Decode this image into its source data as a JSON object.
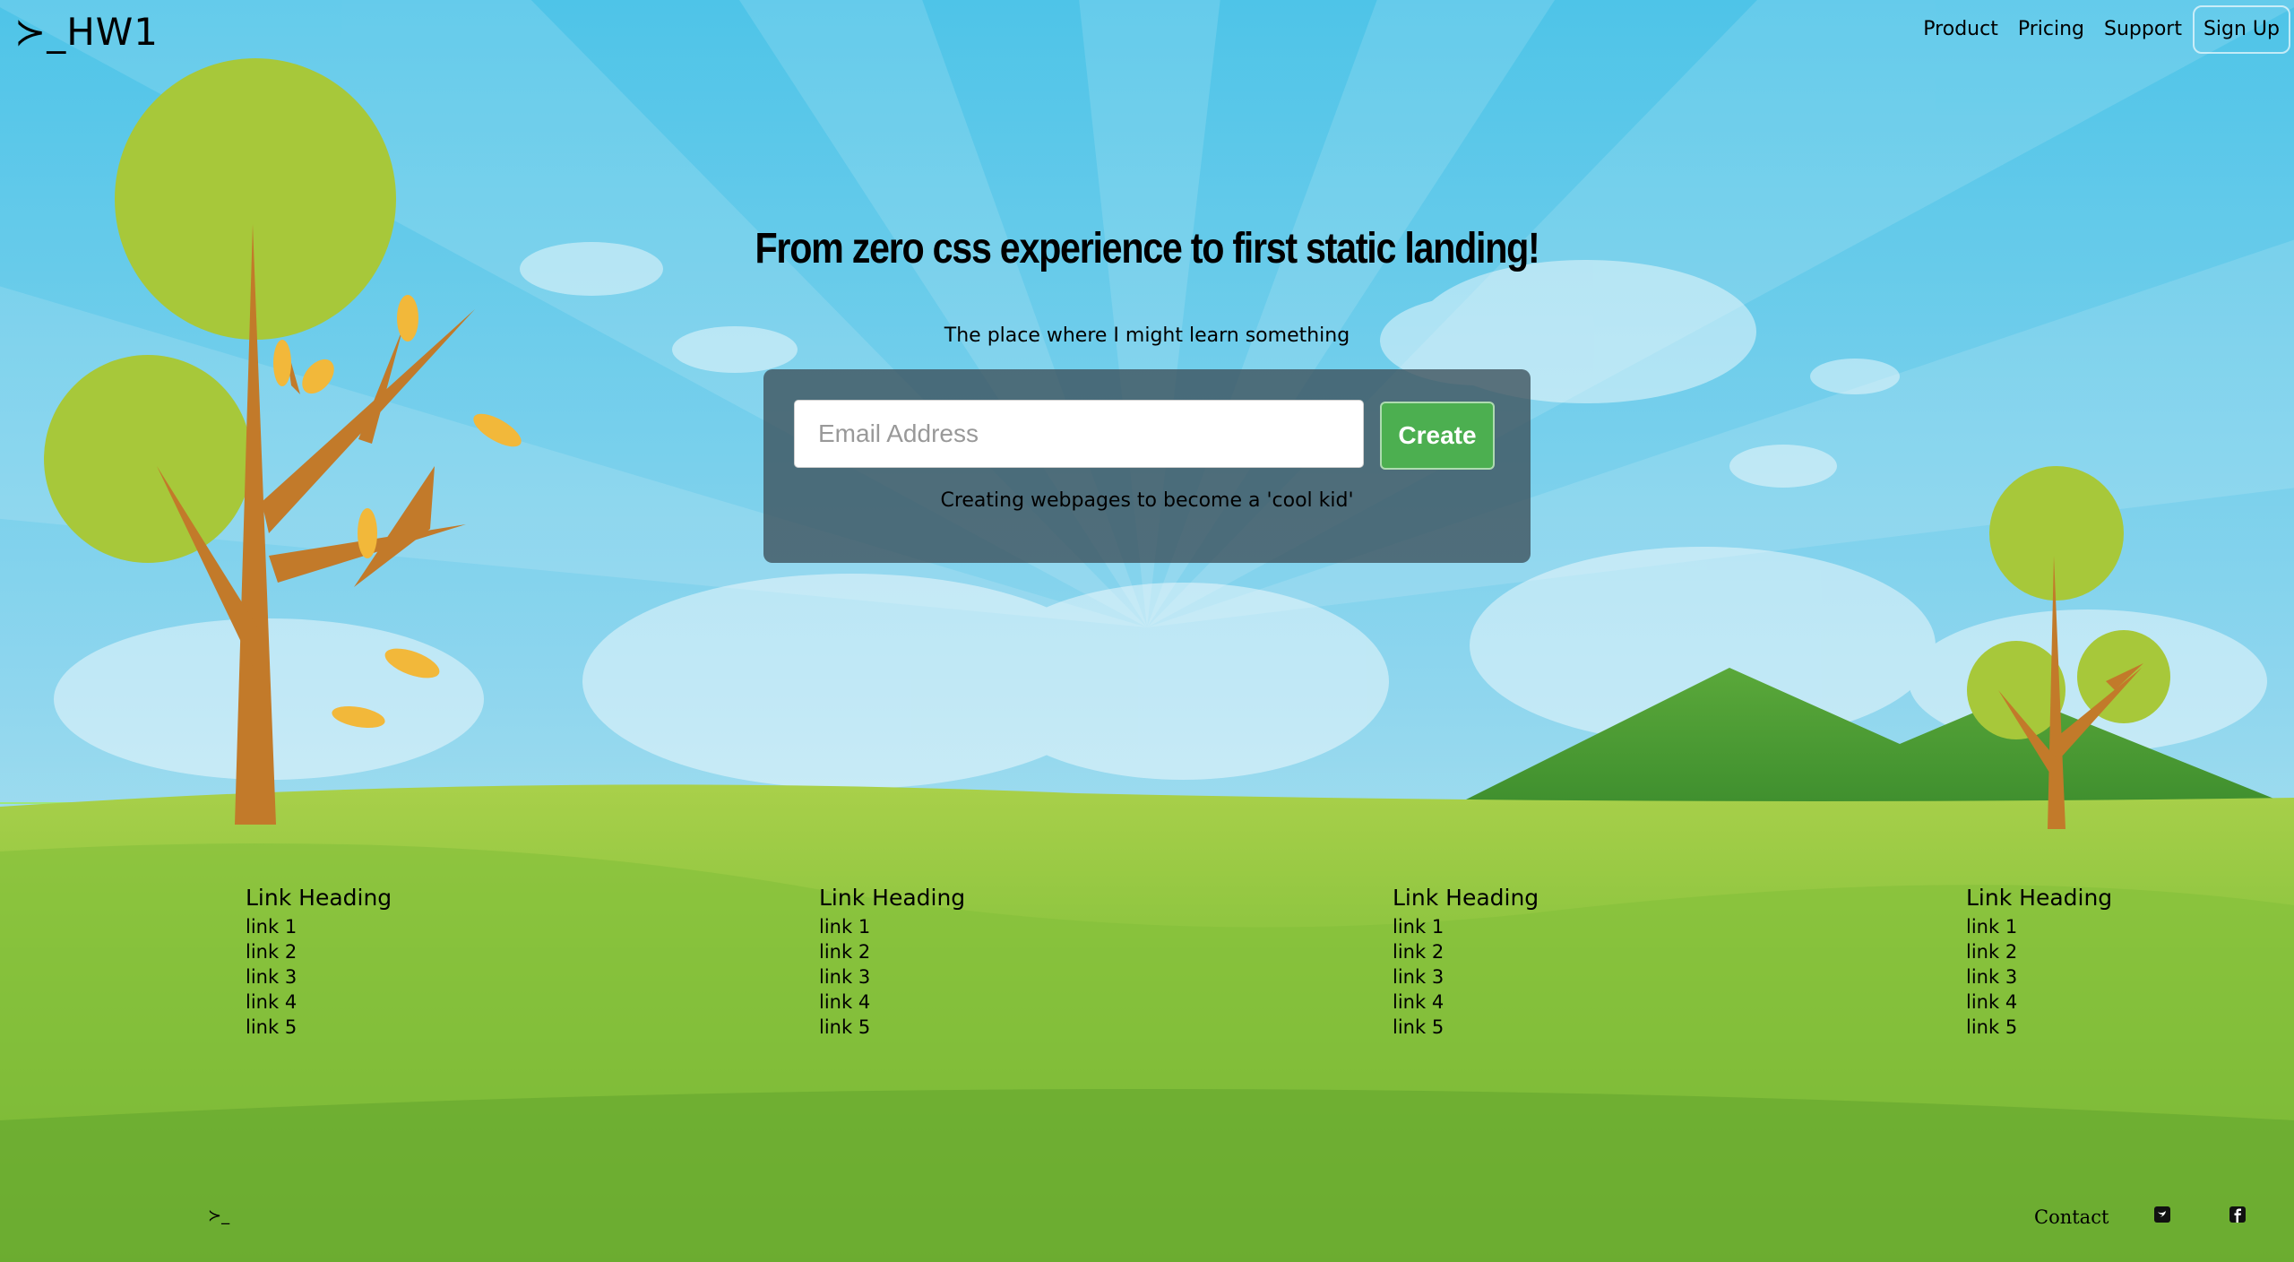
{
  "brand": {
    "text": "≻_HW1"
  },
  "nav": {
    "items": [
      "Product",
      "Pricing",
      "Support"
    ],
    "signup": "Sign Up"
  },
  "hero": {
    "title": "From zero css experience to first static landing!",
    "subtitle": "The place where I might learn something",
    "email_placeholder": "Email Address",
    "create_label": "Create",
    "note": "Creating webpages to become a 'cool kid'"
  },
  "link_columns": [
    {
      "heading": "Link Heading",
      "links": [
        "link 1",
        "link 2",
        "link 3",
        "link 4",
        "link 5"
      ]
    },
    {
      "heading": "Link Heading",
      "links": [
        "link 1",
        "link 2",
        "link 3",
        "link 4",
        "link 5"
      ]
    },
    {
      "heading": "Link Heading",
      "links": [
        "link 1",
        "link 2",
        "link 3",
        "link 4",
        "link 5"
      ]
    },
    {
      "heading": "Link Heading",
      "links": [
        "link 1",
        "link 2",
        "link 3",
        "link 4",
        "link 5"
      ]
    }
  ],
  "footer": {
    "mark": "≻_",
    "contact": "Contact",
    "icons": [
      "twitter-icon",
      "facebook-icon"
    ]
  },
  "colors": {
    "sky_top": "#4ec4e8",
    "sky_bottom": "#c9ebf1",
    "grass": "#7dba36",
    "create_button": "#4caf50",
    "panel": "#3c505a"
  }
}
